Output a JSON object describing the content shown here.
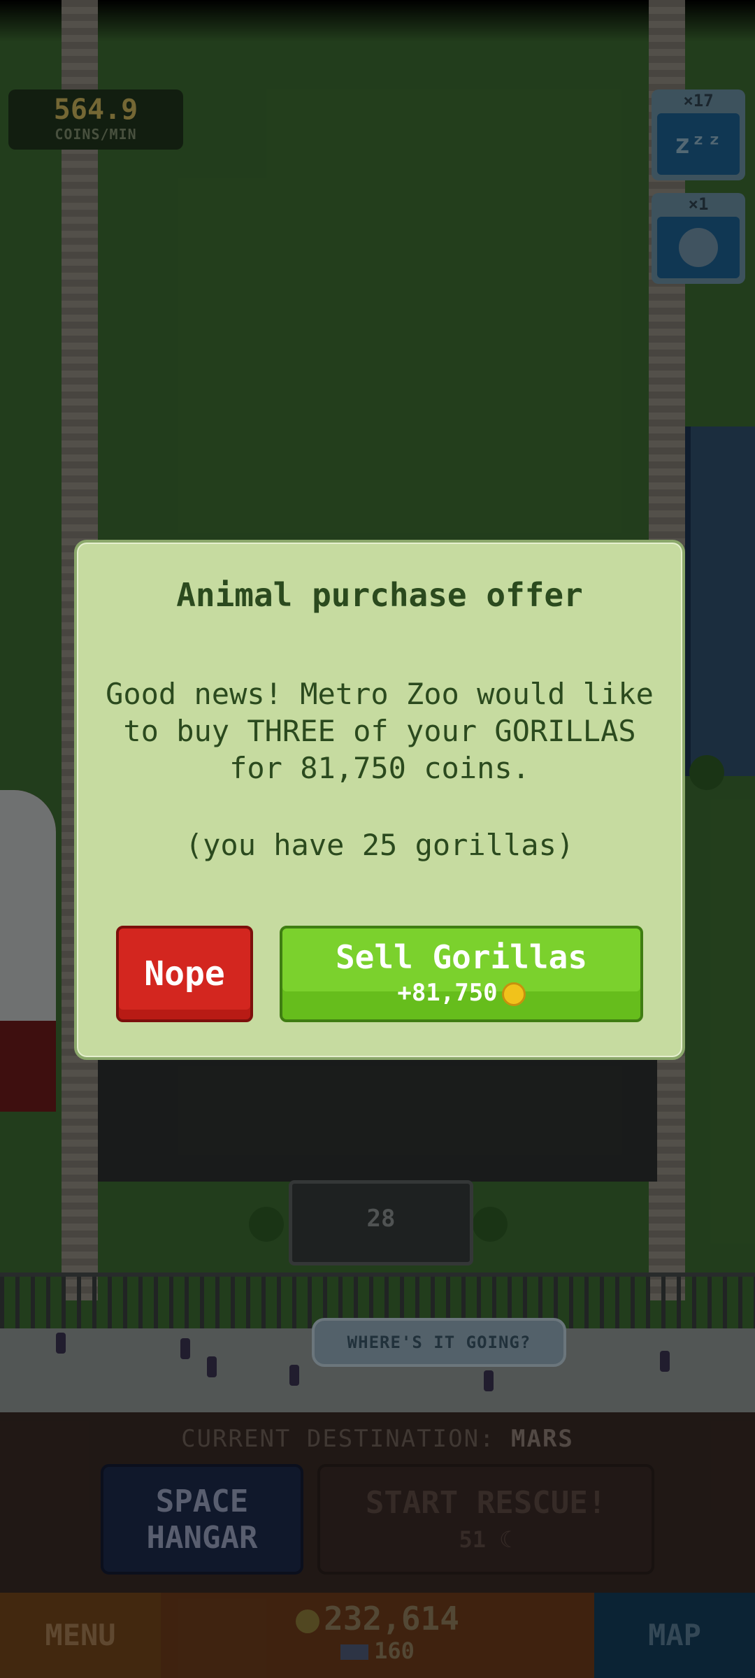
{
  "hud": {
    "rate_value": "564.9",
    "rate_label": "COINS/MIN",
    "powerups": [
      {
        "count": "×17",
        "icon": "zzz-icon",
        "glyph": "zᶻᶻ"
      },
      {
        "count": "×1",
        "icon": "boost-orb-icon",
        "glyph": ""
      }
    ]
  },
  "world": {
    "sign_value": "28",
    "where_label": "WHERE'S IT GOING?"
  },
  "dialog": {
    "title": "Animal purchase offer",
    "body": "Good news! Metro Zoo would like to buy THREE of your GORILLAS for 81,750 coins.",
    "note": "(you have 25 gorillas)",
    "decline_label": "Nope",
    "sell_label": "Sell Gorillas",
    "sell_amount": "+81,750"
  },
  "panel": {
    "destination_prefix": "CURRENT DESTINATION:",
    "destination": "MARS",
    "hangar_line1": "SPACE",
    "hangar_line2": "HANGAR",
    "rescue_label": "START RESCUE!",
    "rescue_cost": "51"
  },
  "bottom_bar": {
    "menu_label": "MENU",
    "coins": "232,614",
    "gems": "160",
    "map_label": "MAP"
  },
  "colors": {
    "dialog_bg": "#c6dba0",
    "nope": "#d3261f",
    "sell": "#7bd12d",
    "coin": "#f1c21b"
  }
}
